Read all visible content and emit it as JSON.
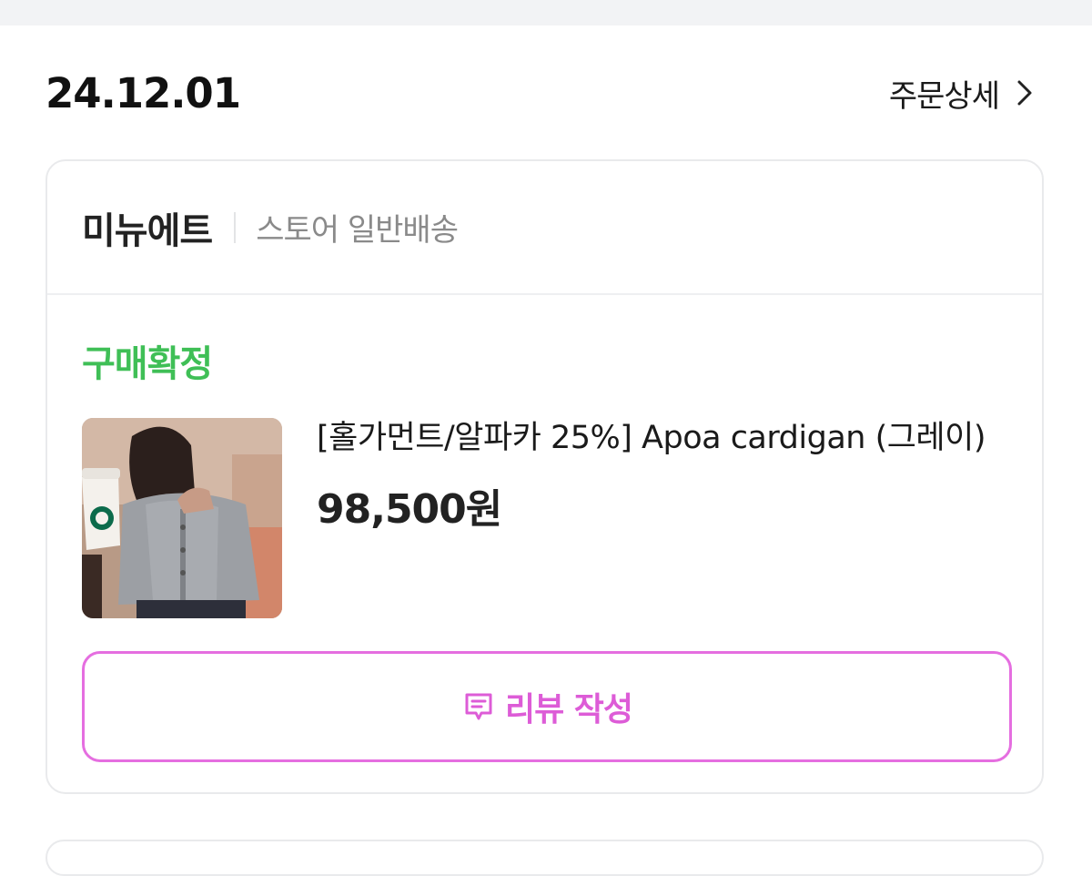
{
  "order": {
    "date": "24.12.01",
    "detail_label": "주문상세"
  },
  "card": {
    "store_name": "미뉴에트",
    "shipping_type": "스토어 일반배송",
    "status": "구매확정",
    "product": {
      "name": "[홀가먼트/알파카 25%] Apoa cardigan (그레이)",
      "price": "98,500원"
    },
    "review_button": {
      "label": "리뷰 작성",
      "icon": "review-chat-icon"
    }
  },
  "colors": {
    "status_green": "#3fbf56",
    "review_pink": "#dd5cd7",
    "review_border": "#e56ee0",
    "border_gray": "#e9eaec"
  }
}
